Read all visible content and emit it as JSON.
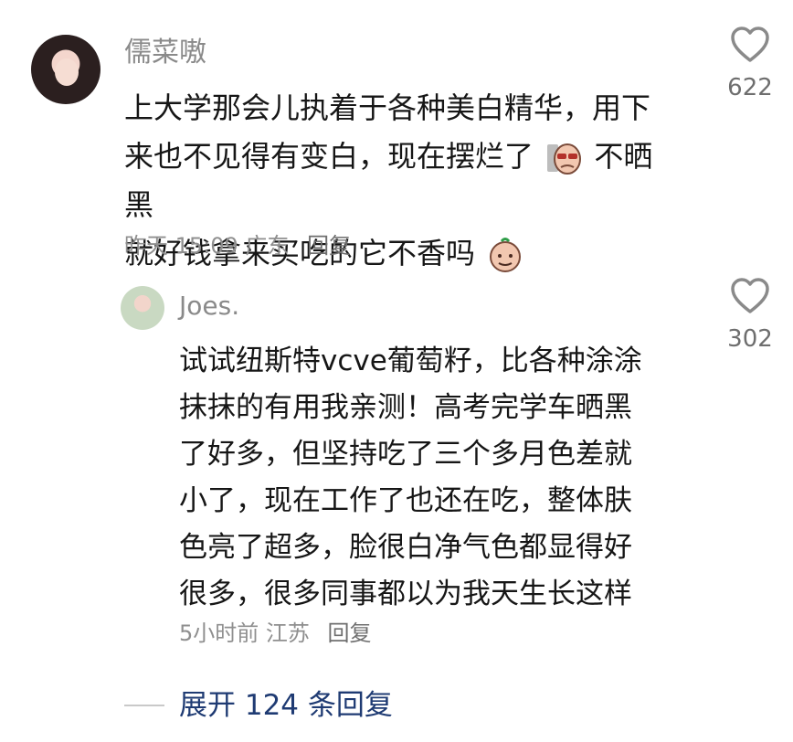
{
  "comments": {
    "main": {
      "username": "儒菜嗷",
      "text_line1": "上大学那会儿执着于各种美白精华，用下",
      "text_line2a": "来也不见得有变白，现在摆烂了",
      "text_line2b": "不晒黑",
      "text_line3": "就好钱拿来买吃的它不香吗",
      "meta": "昨天 15:09 广东",
      "reply_label": "回复",
      "likes": "622"
    },
    "reply": {
      "username": "Joes.",
      "text_lines": [
        "试试纽斯特vcve葡萄籽，比各种涂涂",
        "抹抹的有用我亲测！高考完学车晒黑",
        "了好多，但坚持吃了三个多月色差就",
        "小了，现在工作了也还在吃，整体肤",
        "色亮了超多，脸很白净气色都显得好",
        "很多，很多同事都以为我天生长这样"
      ],
      "meta": "5小时前 江苏",
      "reply_label": "回复",
      "likes": "302"
    }
  },
  "expand": {
    "label": "展开 124 条回复"
  },
  "icons": {
    "like": "heart-outline-icon",
    "emoji1": "face-with-sunglasses-emoji",
    "emoji2": "face-emoji"
  }
}
